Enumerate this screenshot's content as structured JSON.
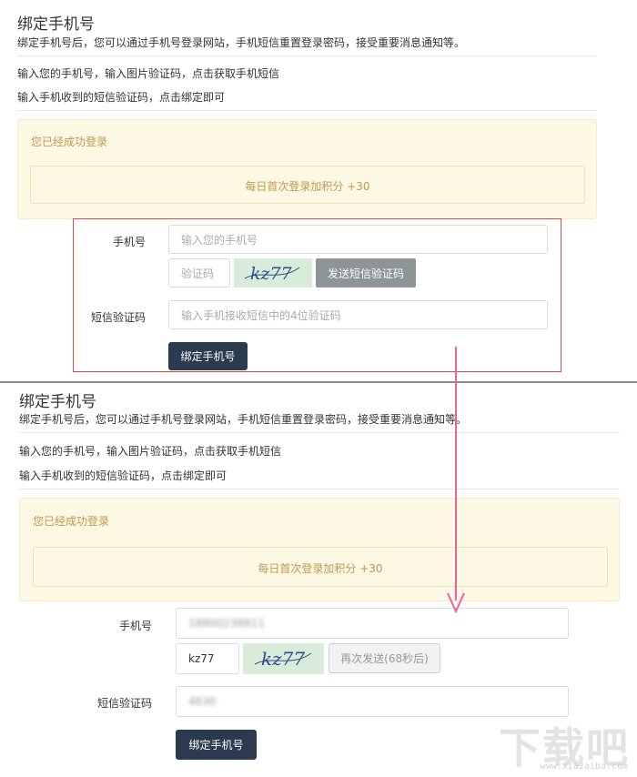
{
  "before": {
    "title": "绑定手机号",
    "description": "绑定手机号后，您可以通过手机号登录网站，手机短信重置登录密码，接受重要消息通知等。",
    "step1": "输入您的手机号，输入图片验证码，点击获取手机短信",
    "step2": "输入手机收到的短信验证码，点击绑定即可",
    "notice": "您已经成功登录",
    "bonus": "每日首次登录加积分 +30",
    "phone_label": "手机号",
    "phone_placeholder": "输入您的手机号",
    "captcha_placeholder": "验证码",
    "captcha_text": "kz77",
    "send_button": "发送短信验证码",
    "sms_label": "短信验证码",
    "sms_placeholder": "输入手机接收短信中的4位验证码",
    "bind_button": "绑定手机号"
  },
  "after": {
    "title": "绑定手机号",
    "description": "绑定手机号后，您可以通过手机号登录网站，手机短信重置登录密码，接受重要消息通知等。",
    "step1": "输入您的手机号，输入图片验证码，点击获取手机短信",
    "step2": "输入手机收到的短信验证码，点击绑定即可",
    "notice": "您已经成功登录",
    "bonus": "每日首次登录加积分 +30",
    "phone_label": "手机号",
    "phone_value": "18800238811",
    "captcha_value": "kz77",
    "captcha_text": "kz77",
    "resend_button": "再次发送(68秒后)",
    "sms_label": "短信验证码",
    "sms_value": "4630",
    "bind_button": "绑定手机号"
  },
  "colors": {
    "notice_bg": "#fcf8e3",
    "notice_text": "#c09853",
    "highlight_border": "#e8454a",
    "arrow": "#f0609a",
    "primary_button": "#2b3a4f",
    "send_button": "#8d9597"
  },
  "watermark": {
    "brand": "下载吧",
    "url": "www.xiazaiba.com"
  }
}
